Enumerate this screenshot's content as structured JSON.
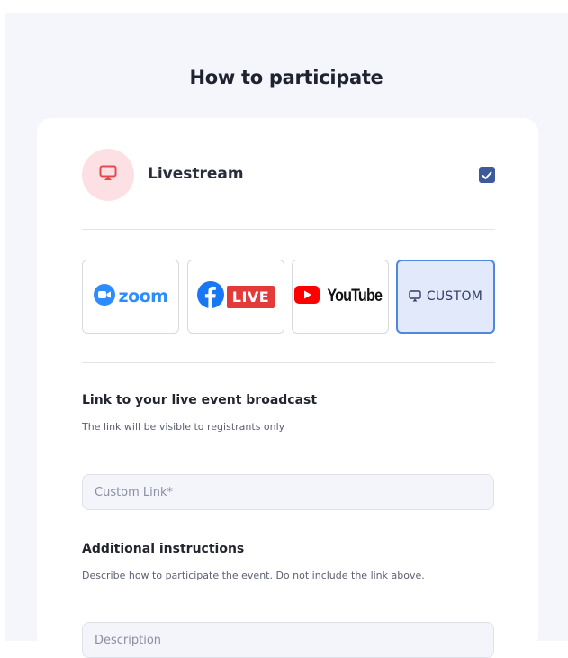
{
  "header": {
    "title": "How to participate"
  },
  "livestream": {
    "label": "Livestream",
    "checked": true,
    "icon": "monitor-icon",
    "accent": "#e5484d"
  },
  "platforms": [
    {
      "id": "zoom",
      "label": "zoom",
      "icon": "zoom-camera-icon",
      "selected": false
    },
    {
      "id": "facebook",
      "label": "LIVE",
      "icon": "facebook-logo-icon",
      "selected": false
    },
    {
      "id": "youtube",
      "label": "YouTube",
      "icon": "youtube-play-icon",
      "selected": false
    },
    {
      "id": "custom",
      "label": "CUSTOM",
      "icon": "monitor-icon",
      "selected": true
    }
  ],
  "link_section": {
    "title": "Link to your live event broadcast",
    "subtitle": "The link will be visible to registrants only",
    "placeholder": "Custom Link*",
    "value": ""
  },
  "instructions_section": {
    "title": "Additional instructions",
    "subtitle": "Describe how to participate the event. Do not include the link above.",
    "placeholder": "Description",
    "value": ""
  },
  "colors": {
    "brand_blue": "#4e86e0",
    "checkbox": "#3d5a99",
    "zoom": "#2d8cff",
    "live_red": "#e53a3a",
    "facebook": "#1877f2",
    "youtube_red": "#ff0000"
  }
}
